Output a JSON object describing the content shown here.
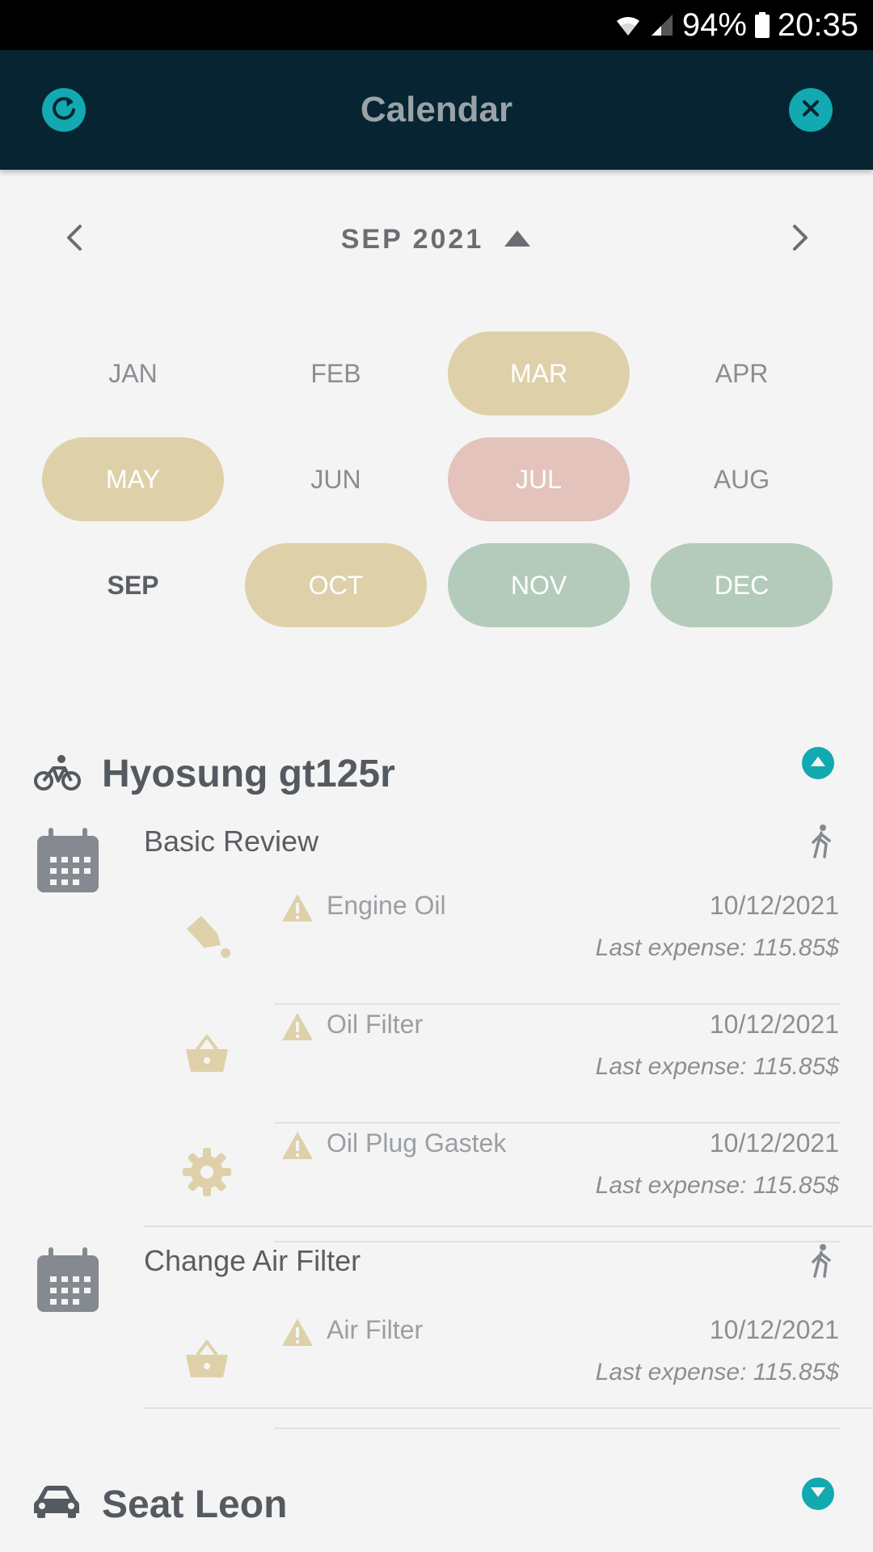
{
  "status_bar": {
    "battery": "94%",
    "time": "20:35"
  },
  "header": {
    "title": "Calendar",
    "refresh_icon": "refresh-icon",
    "close_icon": "close-icon"
  },
  "month_nav": {
    "label": "SEP 2021",
    "prev_icon": "chevron-left-icon",
    "next_icon": "chevron-right-icon",
    "toggle_icon": "triangle-up-icon"
  },
  "months": [
    {
      "label": "JAN",
      "status": "none"
    },
    {
      "label": "FEB",
      "status": "none"
    },
    {
      "label": "MAR",
      "status": "due"
    },
    {
      "label": "APR",
      "status": "none"
    },
    {
      "label": "MAY",
      "status": "due"
    },
    {
      "label": "JUN",
      "status": "none"
    },
    {
      "label": "JUL",
      "status": "overdue"
    },
    {
      "label": "AUG",
      "status": "none"
    },
    {
      "label": "SEP",
      "status": "current"
    },
    {
      "label": "OCT",
      "status": "due"
    },
    {
      "label": "NOV",
      "status": "done"
    },
    {
      "label": "DEC",
      "status": "done"
    }
  ],
  "colors": {
    "accent": "#12a9b0",
    "header_bg": "#062431",
    "due": "#ded1a9",
    "overdue": "#e4c3bd",
    "done": "#b4cbbb"
  },
  "vehicles": [
    {
      "name": "Hyosung gt125r",
      "icon": "bicycle-icon",
      "expanded": true,
      "tasks": [
        {
          "title": "Basic Review",
          "items": [
            {
              "name": "Engine Oil",
              "date": "10/12/2021",
              "expense": "Last expense: 115.85$",
              "icon": "oil-can-icon"
            },
            {
              "name": "Oil Filter",
              "date": "10/12/2021",
              "expense": "Last expense: 115.85$",
              "icon": "basket-icon"
            },
            {
              "name": "Oil Plug Gastek",
              "date": "10/12/2021",
              "expense": "Last expense: 115.85$",
              "icon": "gear-icon"
            }
          ]
        },
        {
          "title": "Change Air Filter",
          "items": [
            {
              "name": "Air Filter",
              "date": "10/12/2021",
              "expense": "Last expense: 115.85$",
              "icon": "basket-icon"
            }
          ]
        }
      ]
    },
    {
      "name": "Seat Leon",
      "icon": "car-icon",
      "expanded": false
    }
  ]
}
